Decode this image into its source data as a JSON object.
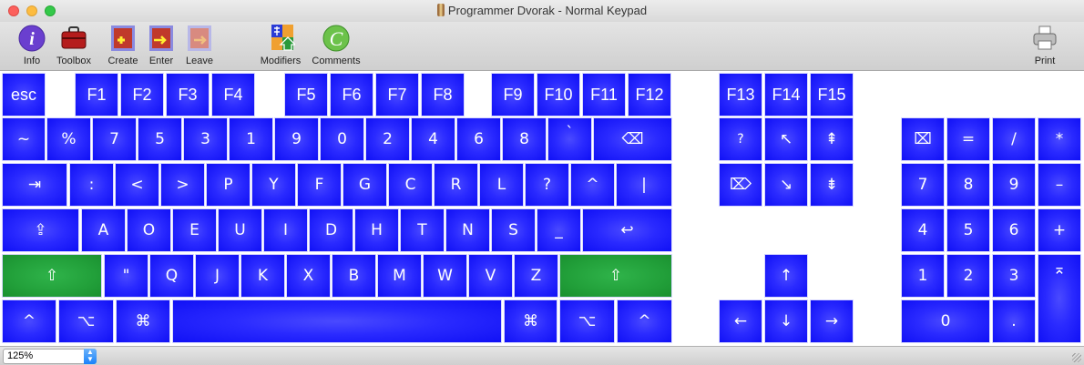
{
  "window": {
    "title": "Programmer Dvorak - Normal Keypad"
  },
  "toolbar": {
    "info": "Info",
    "toolbox": "Toolbox",
    "create": "Create",
    "enter": "Enter",
    "leave": "Leave",
    "modifiers": "Modifiers",
    "comments": "Comments",
    "print": "Print",
    "comments_icon_letter": "C",
    "info_icon_letter": "i"
  },
  "keys": {
    "esc": "esc",
    "f1": "F1",
    "f2": "F2",
    "f3": "F3",
    "f4": "F4",
    "f5": "F5",
    "f6": "F6",
    "f7": "F7",
    "f8": "F8",
    "f9": "F9",
    "f10": "F10",
    "f11": "F11",
    "f12": "F12",
    "f13": "F13",
    "f14": "F14",
    "f15": "F15",
    "r1": [
      "~",
      "%",
      "7",
      "5",
      "3",
      "1",
      "9",
      "0",
      "2",
      "4",
      "6",
      "8",
      "`"
    ],
    "backspace": "⌫",
    "tab": "⇥",
    "r2": [
      ":",
      "<",
      ">",
      "P",
      "Y",
      "F",
      "G",
      "C",
      "R",
      "L",
      "?",
      "^",
      "|"
    ],
    "capslock": "⇪",
    "r3": [
      "A",
      "O",
      "E",
      "U",
      "I",
      "D",
      "H",
      "T",
      "N",
      "S",
      "_"
    ],
    "return": "↩",
    "shift_left": "⇧",
    "r4": [
      "\"",
      "Q",
      "J",
      "K",
      "X",
      "B",
      "M",
      "W",
      "V",
      "Z"
    ],
    "shift_right": "⇧",
    "ctrl_left": "^",
    "opt_left": "⌥",
    "cmd_left": "⌘",
    "space": "",
    "cmd_right": "⌘",
    "opt_right": "⌥",
    "ctrl_right": "^",
    "help": "?",
    "home": "↖",
    "pageup": "⇞",
    "fwddelete": "⌦",
    "end": "↘",
    "pagedown": "⇟",
    "up": "↑",
    "left": "←",
    "down": "↓",
    "right": "→",
    "np_clear": "⌧",
    "np_equals": "=",
    "np_divide": "/",
    "np_multiply": "*",
    "np_7": "7",
    "np_8": "8",
    "np_9": "9",
    "np_minus": "–",
    "np_4": "4",
    "np_5": "5",
    "np_6": "6",
    "np_plus": "+",
    "np_1": "1",
    "np_2": "2",
    "np_3": "3",
    "np_enter": "⌅",
    "np_0": "0",
    "np_dot": "."
  },
  "status": {
    "zoom": "125%"
  },
  "colors": {
    "key_blue": "#1a1aff",
    "modifier_green": "#22a03a"
  }
}
